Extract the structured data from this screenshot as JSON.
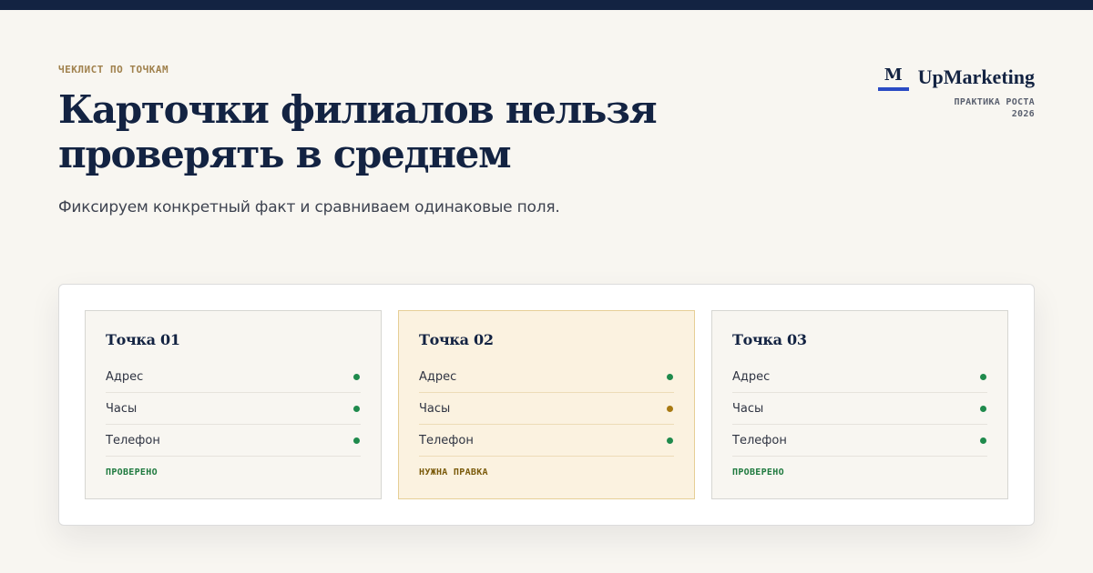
{
  "eyebrow": "ЧЕКЛИСТ ПО ТОЧКАМ",
  "title": "Карточки филиалов нельзя проверять в среднем",
  "subtitle": "Фиксируем конкретный факт и сравниваем одинаковые поля.",
  "brand": {
    "mark": "M",
    "name": "UpMarketing",
    "tagline": "ПРАКТИКА РОСТА",
    "year": "2026"
  },
  "colors": {
    "ok": "#1f8a4c",
    "warn": "#a87a12",
    "ok_text": "#1f7a3f",
    "warn_text": "#7a5a0a"
  },
  "cards": [
    {
      "title": "Точка 01",
      "variant": "normal",
      "fields": [
        {
          "label": "Адрес",
          "state": "ok"
        },
        {
          "label": "Часы",
          "state": "ok"
        },
        {
          "label": "Телефон",
          "state": "ok"
        }
      ],
      "status": "ПРОВЕРЕНО",
      "status_state": "ok"
    },
    {
      "title": "Точка 02",
      "variant": "warn",
      "fields": [
        {
          "label": "Адрес",
          "state": "ok"
        },
        {
          "label": "Часы",
          "state": "warn"
        },
        {
          "label": "Телефон",
          "state": "ok"
        }
      ],
      "status": "НУЖНА ПРАВКА",
      "status_state": "warn"
    },
    {
      "title": "Точка 03",
      "variant": "normal",
      "fields": [
        {
          "label": "Адрес",
          "state": "ok"
        },
        {
          "label": "Часы",
          "state": "ok"
        },
        {
          "label": "Телефон",
          "state": "ok"
        }
      ],
      "status": "ПРОВЕРЕНО",
      "status_state": "ok"
    }
  ]
}
